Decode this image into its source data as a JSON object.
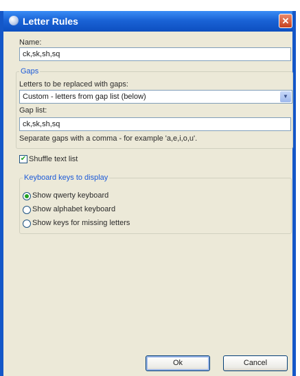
{
  "window": {
    "title": "Letter Rules",
    "close_icon": "close-icon"
  },
  "name_field": {
    "label": "Name:",
    "value": "ck,sk,sh,sq"
  },
  "gaps": {
    "legend": "Gaps",
    "replace_label": "Letters to be replaced with gaps:",
    "replace_value": "Custom - letters from gap list (below)",
    "gap_list_label": "Gap list:",
    "gap_list_value": "ck,sk,sh,sq",
    "hint": "Separate gaps with a comma - for example 'a,e,i,o,u'."
  },
  "shuffle": {
    "label": "Shuffle text list",
    "checked": true
  },
  "keyboard": {
    "legend": "Keyboard keys to display",
    "options": [
      {
        "label": "Show qwerty keyboard",
        "selected": true
      },
      {
        "label": "Show alphabet keyboard",
        "selected": false
      },
      {
        "label": "Show keys for missing letters",
        "selected": false
      }
    ]
  },
  "buttons": {
    "ok": "Ok",
    "cancel": "Cancel"
  }
}
